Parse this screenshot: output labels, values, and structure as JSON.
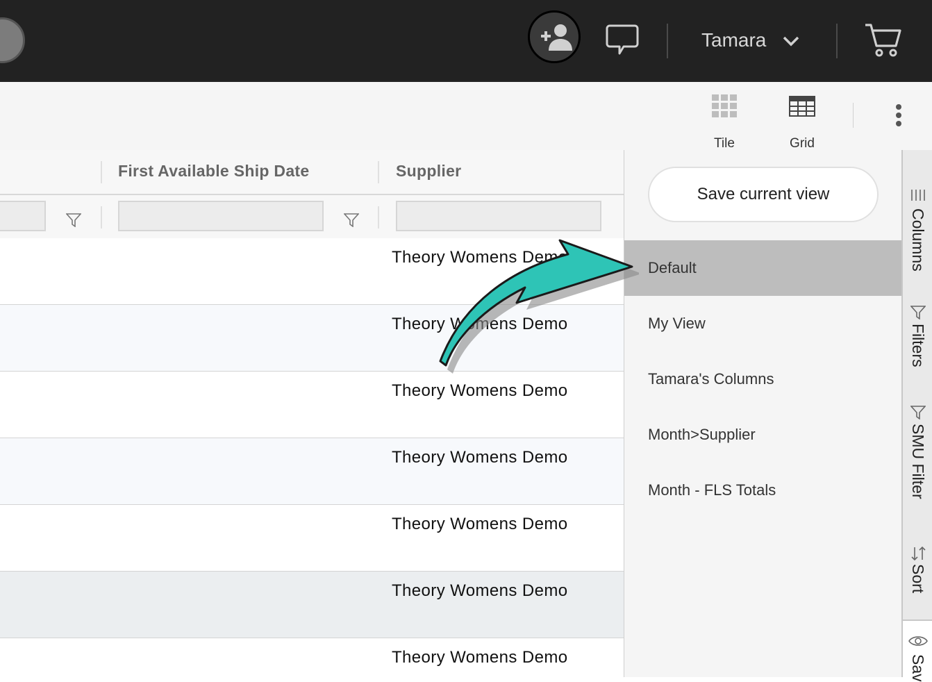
{
  "topbar": {
    "user_name": "Tamara",
    "icons": [
      "avatar-icon",
      "add-user-icon",
      "chat-icon",
      "chevron-down-icon",
      "cart-icon"
    ]
  },
  "toolbar": {
    "tile_label": "Tile",
    "grid_label": "Grid"
  },
  "grid": {
    "columns": [
      "First Available Ship Date",
      "Supplier"
    ],
    "rows": [
      {
        "supplier": "Theory Womens Demo",
        "highlight": false
      },
      {
        "supplier": "Theory Womens Demo",
        "highlight": true
      },
      {
        "supplier": "Theory Womens Demo",
        "highlight": false
      },
      {
        "supplier": "Theory Womens Demo",
        "highlight": true
      },
      {
        "supplier": "Theory Womens Demo",
        "highlight": false
      },
      {
        "supplier": "Theory Womens Demo",
        "highlight": "hover"
      },
      {
        "supplier": "Theory Womens Demo",
        "highlight": false
      }
    ]
  },
  "views_panel": {
    "save_label": "Save current view",
    "items": [
      "Default",
      "My View",
      "Tamara's Columns",
      "Month>Supplier",
      "Month - FLS Totals"
    ],
    "selected": "Default"
  },
  "side_tabs": [
    "Columns",
    "Filters",
    "SMU Filter",
    "Sort",
    "Sav"
  ],
  "colors": {
    "topbar": "#222222",
    "arrow": "#2ec4b6",
    "selected_item": "#bdbdbd",
    "alt_row": "#f7f9fc",
    "hover_row": "#ebeef0"
  }
}
